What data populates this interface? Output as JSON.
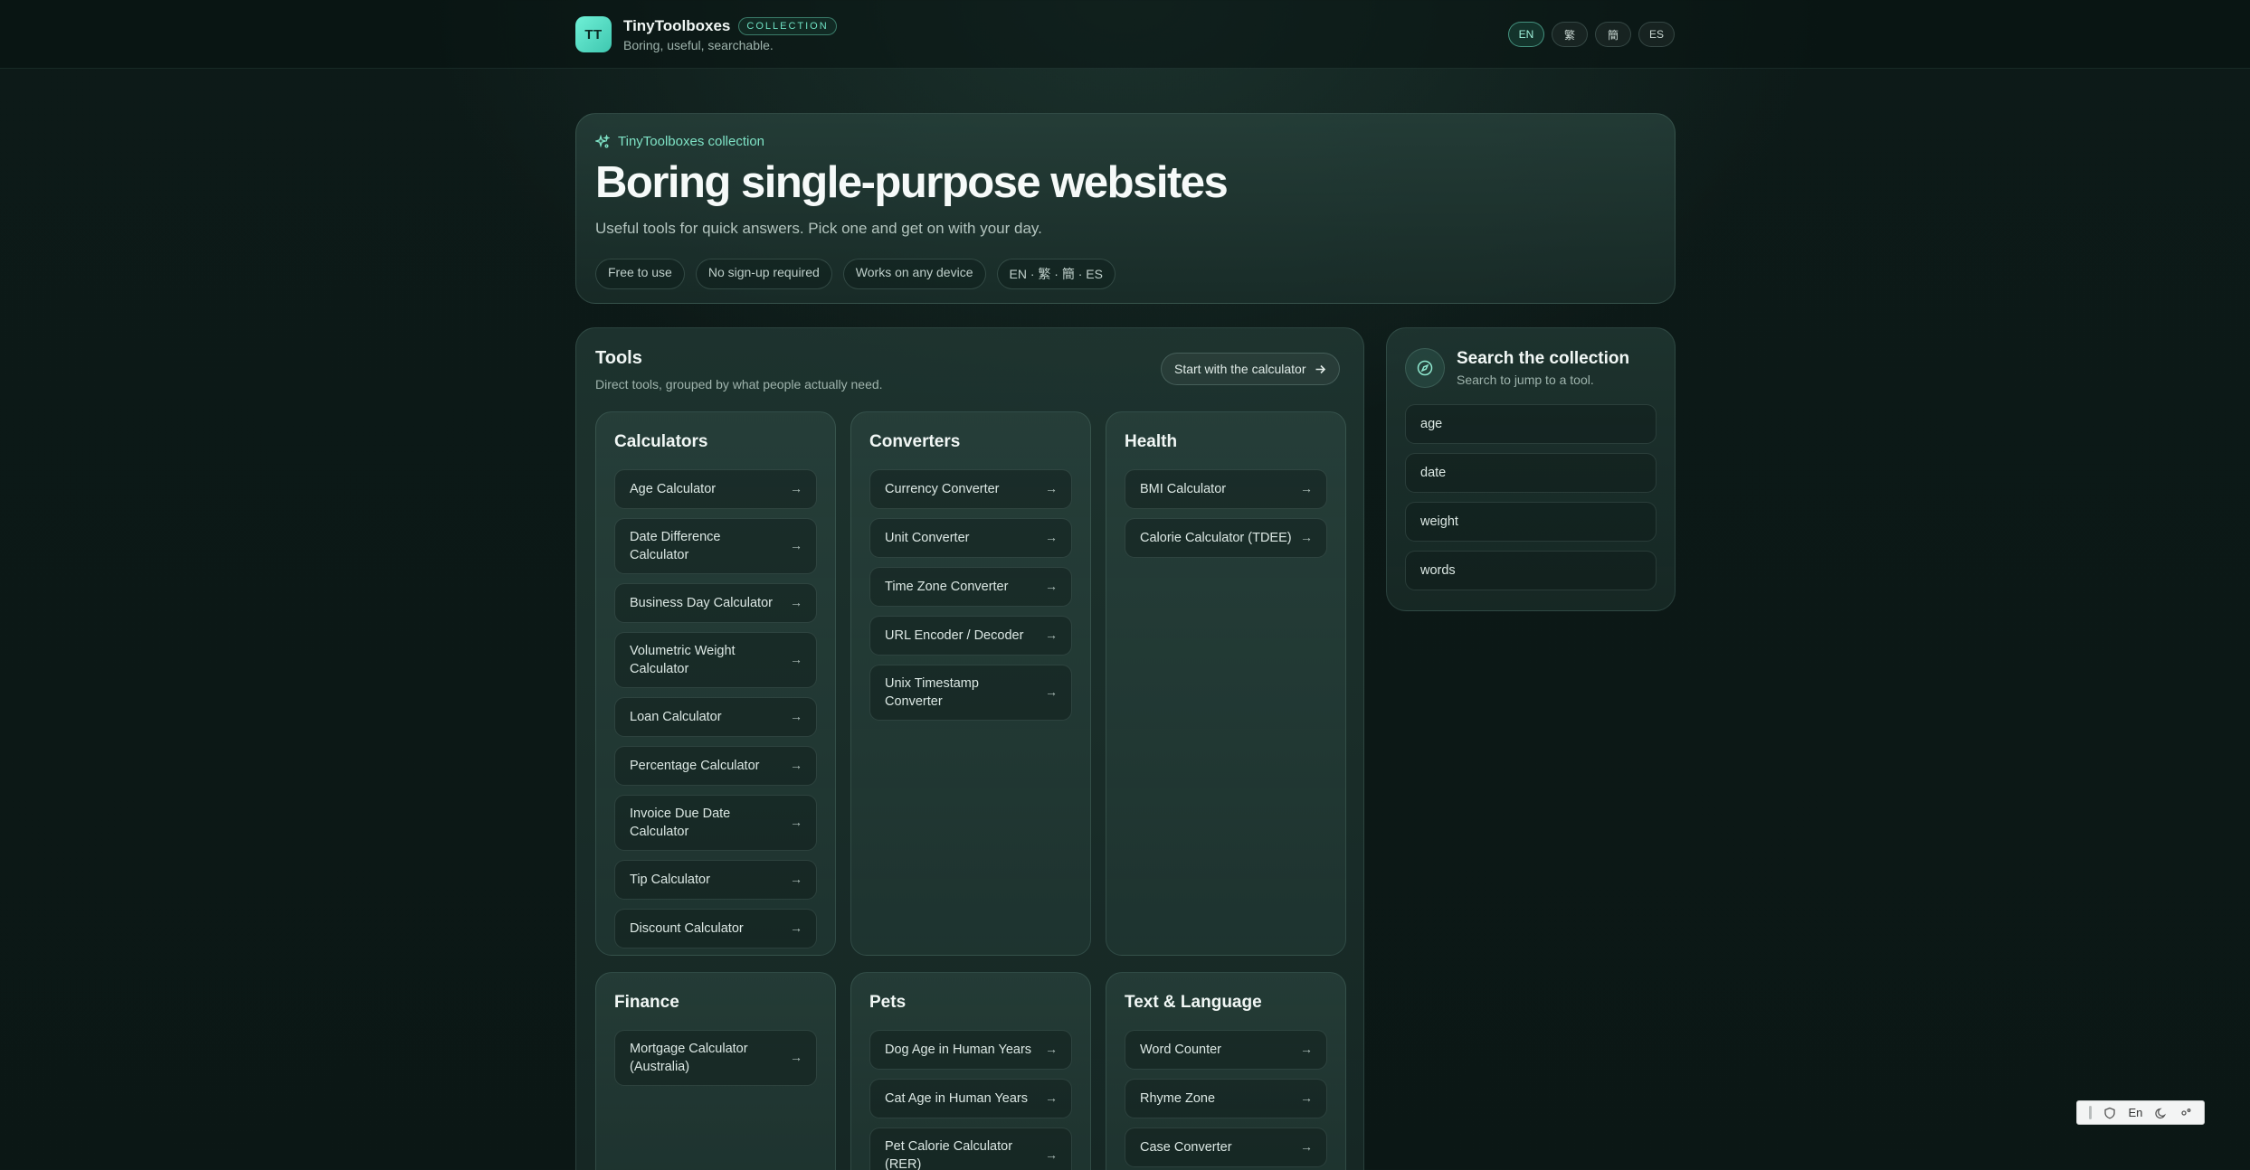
{
  "header": {
    "logo_initials": "TT",
    "brand_name": "TinyToolboxes",
    "badge": "COLLECTION",
    "tagline": "Boring, useful, searchable.",
    "languages": [
      "EN",
      "繁",
      "簡",
      "ES"
    ],
    "active_language": "EN"
  },
  "hero": {
    "kicker": "TinyToolboxes collection",
    "title": "Boring single-purpose websites",
    "subtitle": "Useful tools for quick answers. Pick one and get on with your day.",
    "chips": [
      "Free to use",
      "No sign-up required",
      "Works on any device",
      "EN · 繁 · 簡 · ES"
    ]
  },
  "tools": {
    "title": "Tools",
    "subtitle": "Direct tools, grouped by what people actually need.",
    "start_button": "Start with the calculator",
    "categories": [
      {
        "name": "Calculators",
        "items": [
          "Age Calculator",
          "Date Difference Calculator",
          "Business Day Calculator",
          "Volumetric Weight Calculator",
          "Loan Calculator",
          "Percentage Calculator",
          "Invoice Due Date Calculator",
          "Tip Calculator",
          "Discount Calculator"
        ]
      },
      {
        "name": "Converters",
        "items": [
          "Currency Converter",
          "Unit Converter",
          "Time Zone Converter",
          "URL Encoder / Decoder",
          "Unix Timestamp Converter"
        ]
      },
      {
        "name": "Health",
        "items": [
          "BMI Calculator",
          "Calorie Calculator (TDEE)"
        ]
      },
      {
        "name": "Finance",
        "items": [
          "Mortgage Calculator (Australia)"
        ]
      },
      {
        "name": "Pets",
        "items": [
          "Dog Age in Human Years",
          "Cat Age in Human Years",
          "Pet Calorie Calculator (RER)"
        ]
      },
      {
        "name": "Text & Language",
        "items": [
          "Word Counter",
          "Rhyme Zone",
          "Case Converter"
        ]
      }
    ]
  },
  "search": {
    "title": "Search the collection",
    "subtitle": "Search to jump to a tool.",
    "suggestions": [
      "age",
      "date",
      "weight",
      "words"
    ]
  },
  "float_toolbar": {
    "lang_label": "En"
  },
  "colors": {
    "accent": "#6ee0c2",
    "background": "#0c1816",
    "panel": "#2a433e"
  }
}
